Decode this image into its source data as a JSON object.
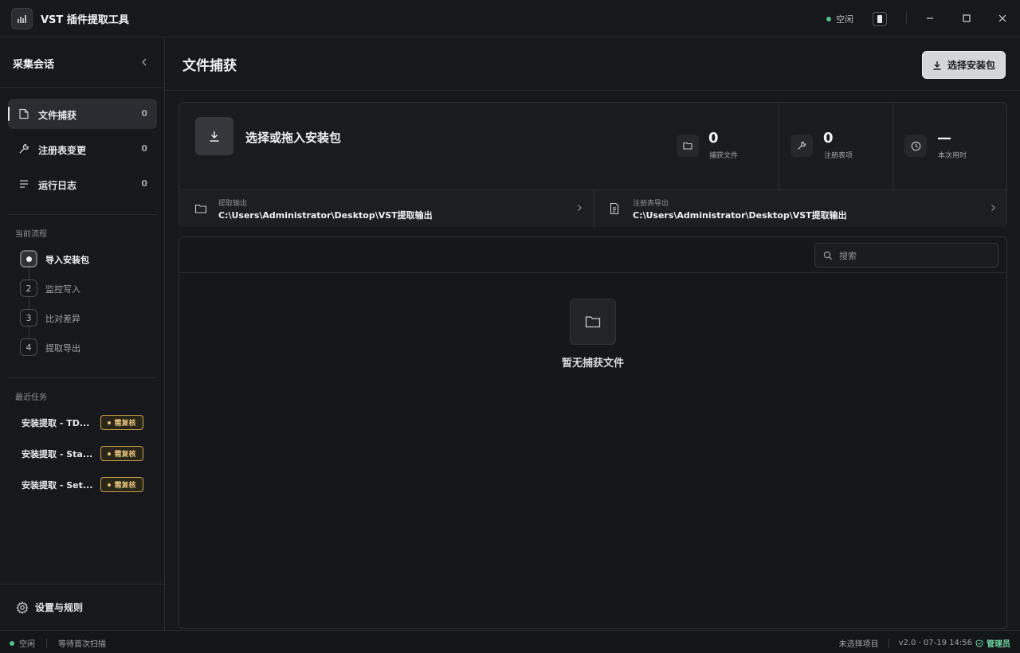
{
  "app": {
    "title": "VST 插件提取工具"
  },
  "titlebar": {
    "status": "空闲"
  },
  "sidebar": {
    "title": "采集会话",
    "nav": [
      {
        "label": "文件捕获",
        "count": "0",
        "icon": "file-icon"
      },
      {
        "label": "注册表变更",
        "count": "0",
        "icon": "wrench-icon"
      },
      {
        "label": "运行日志",
        "count": "0",
        "icon": "list-icon"
      }
    ],
    "flow_title": "当前流程",
    "steps": [
      {
        "num": "",
        "label": "导入安装包"
      },
      {
        "num": "2",
        "label": "监控写入"
      },
      {
        "num": "3",
        "label": "比对差异"
      },
      {
        "num": "4",
        "label": "提取导出"
      }
    ],
    "recent_title": "最近任务",
    "tasks": [
      {
        "name": "安装提取 - TD...",
        "badge": "需复核"
      },
      {
        "name": "安装提取 - Sta...",
        "badge": "需复核"
      },
      {
        "name": "安装提取 - Set...",
        "badge": "需复核"
      }
    ],
    "settings_label": "设置与规则"
  },
  "main": {
    "title": "文件捕获",
    "primary_button": "选择安装包",
    "upload_title": "选择或拖入安装包",
    "stats": [
      {
        "value": "0",
        "label": "捕获文件",
        "icon": "folder-icon"
      },
      {
        "value": "0",
        "label": "注册表项",
        "icon": "wrench-icon"
      },
      {
        "value": "—",
        "label": "本次用时",
        "icon": "clock-icon"
      }
    ],
    "paths": [
      {
        "label": "提取输出",
        "value": "C:\\Users\\Administrator\\Desktop\\VST提取输出",
        "icon": "folder-icon"
      },
      {
        "label": "注册表导出",
        "value": "C:\\Users\\Administrator\\Desktop\\VST提取输出",
        "icon": "document-icon"
      }
    ],
    "search_placeholder": "搜索",
    "empty_text": "暂无捕获文件"
  },
  "statusbar": {
    "status": "空闲",
    "message": "等待首次扫描",
    "project": "未选择项目",
    "version": "v2.0 · 07-19 14:56",
    "role": "管理员"
  },
  "colors": {
    "background": "#17181b",
    "accent_green": "#4cc38a",
    "badge_amber": "#e3c27a",
    "primary_button": "#d4d6da"
  }
}
